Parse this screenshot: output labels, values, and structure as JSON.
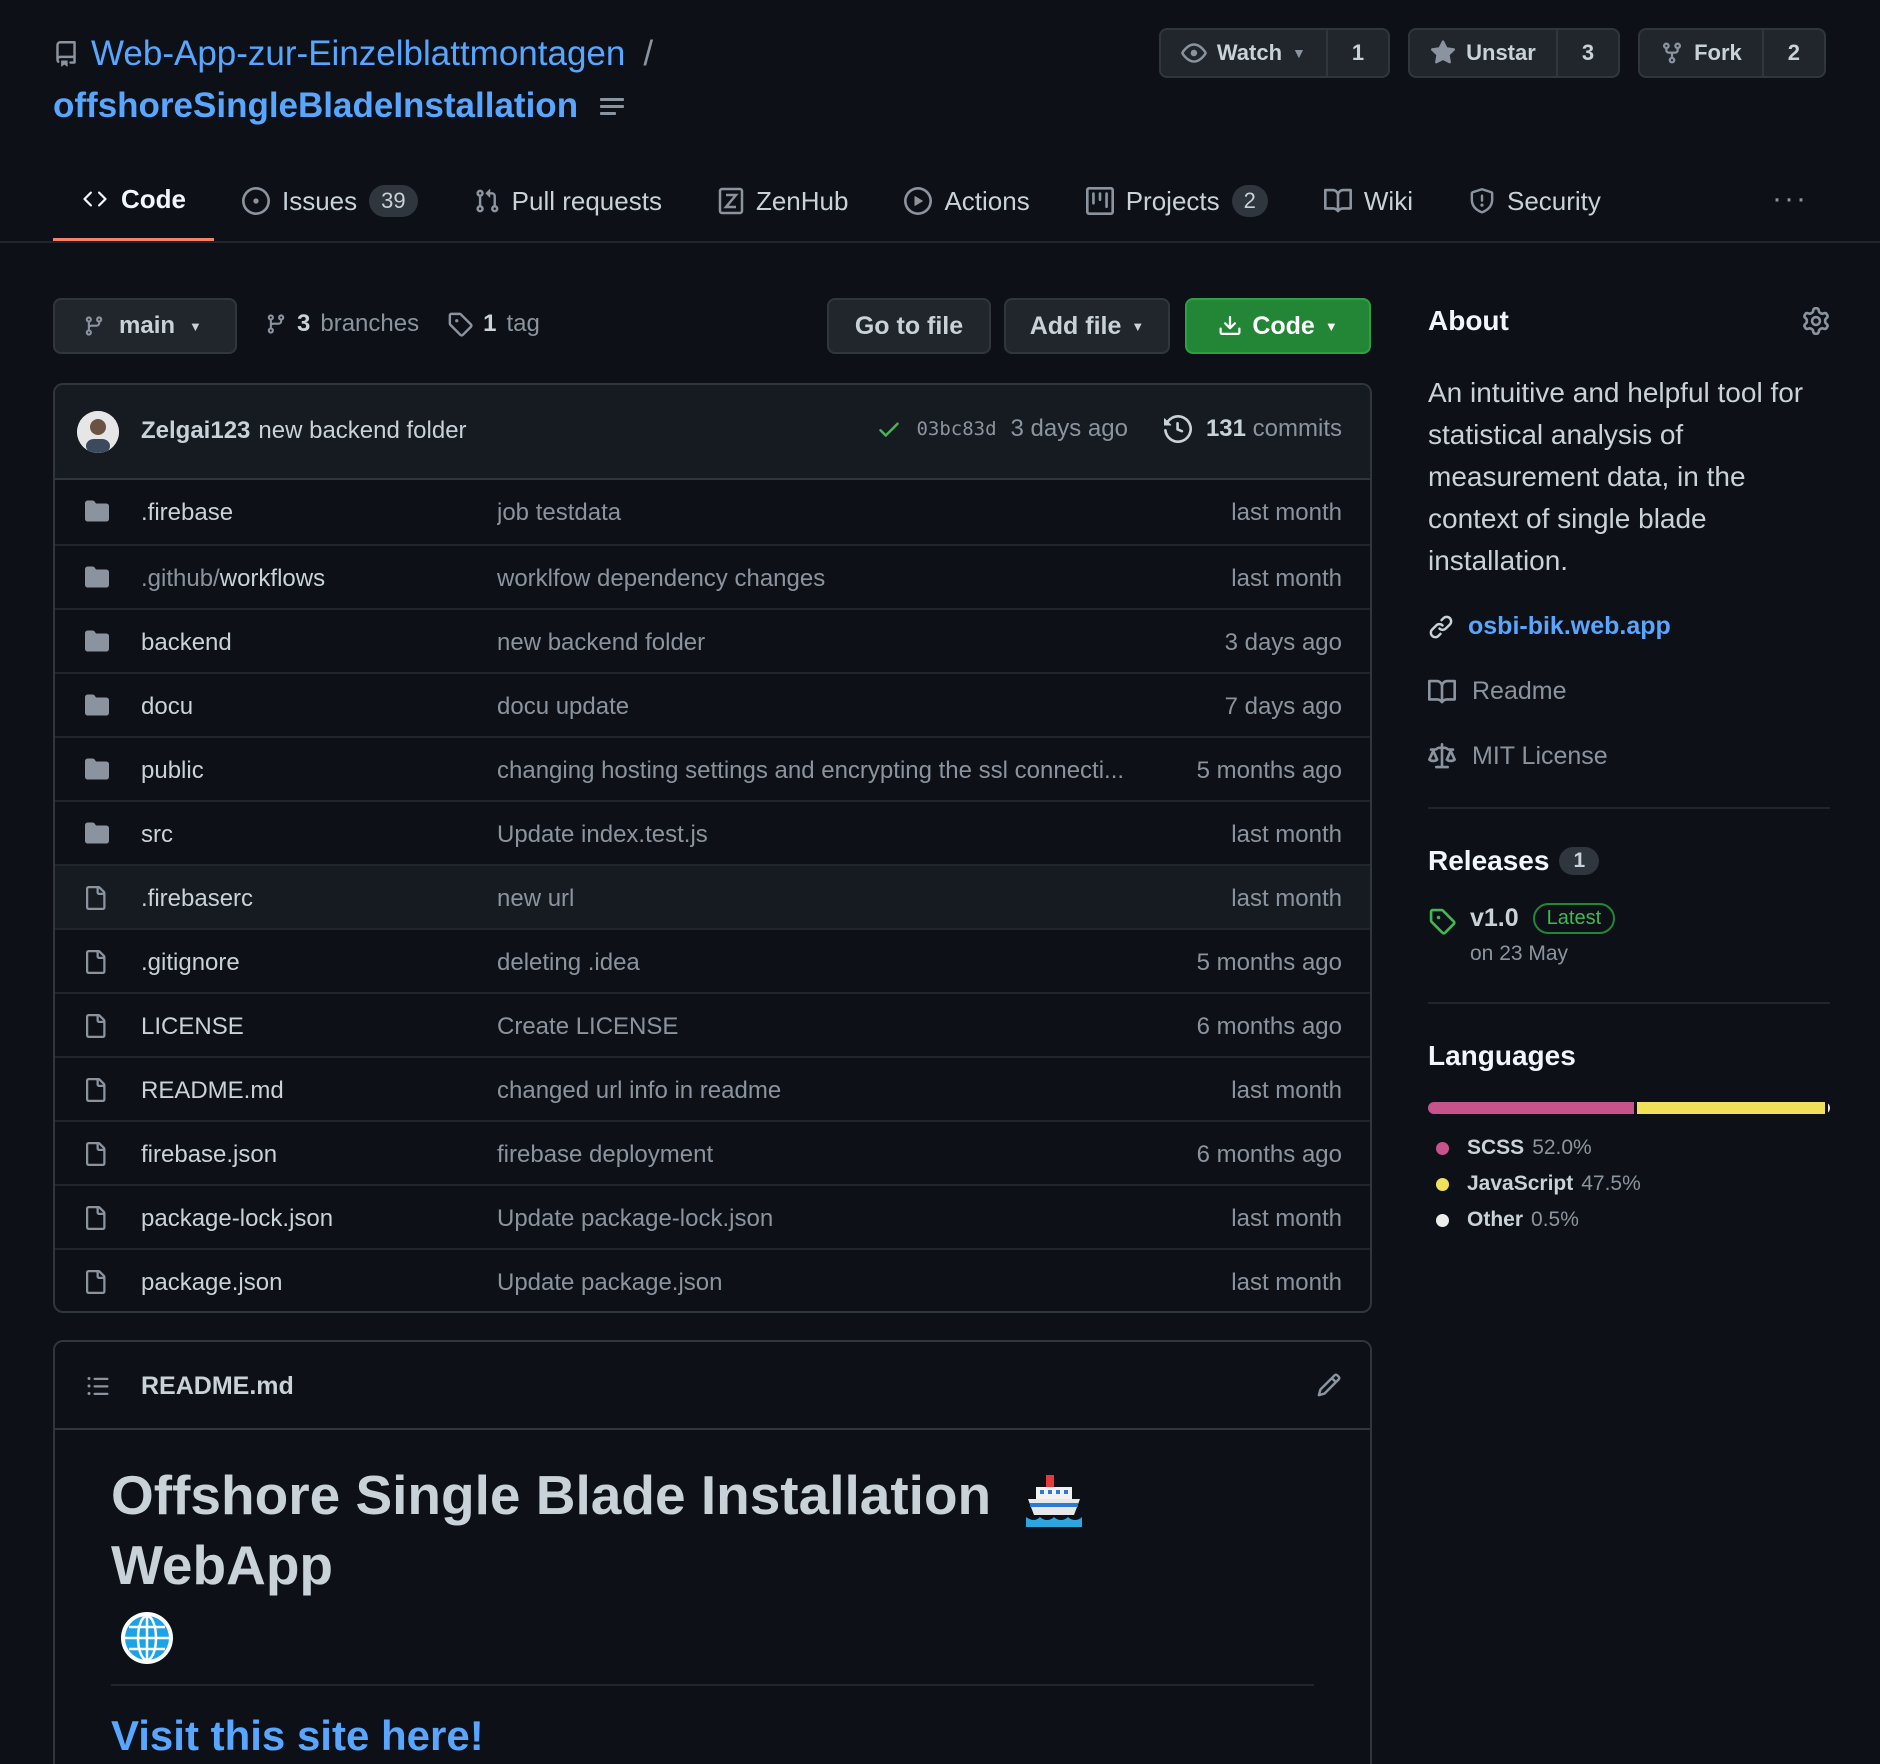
{
  "repo": {
    "owner": "Web-App-zur-Einzelblattmontagen",
    "name": "offshoreSingleBladeInstallation",
    "separator": "/"
  },
  "actions": {
    "watch_label": "Watch",
    "watch_count": "1",
    "star_label": "Unstar",
    "star_count": "3",
    "fork_label": "Fork",
    "fork_count": "2"
  },
  "tabs": [
    {
      "label": "Code"
    },
    {
      "label": "Issues",
      "badge": "39"
    },
    {
      "label": "Pull requests"
    },
    {
      "label": "ZenHub"
    },
    {
      "label": "Actions"
    },
    {
      "label": "Projects",
      "badge": "2"
    },
    {
      "label": "Wiki"
    },
    {
      "label": "Security"
    }
  ],
  "tabs_more": "···",
  "filenav": {
    "branch": "main",
    "branches_count": "3",
    "branches_label": "branches",
    "tags_count": "1",
    "tags_label": "tag",
    "go_to_file": "Go to file",
    "add_file": "Add file",
    "code": "Code"
  },
  "commit": {
    "author": "Zelgai123",
    "message": "new backend folder",
    "sha": "03bc83d",
    "time": "3 days ago",
    "commits_count": "131",
    "commits_label": "commits"
  },
  "files": [
    {
      "type": "dir",
      "name": ".firebase",
      "msg": "job testdata",
      "age": "last month"
    },
    {
      "type": "dir",
      "name_dim": ".github/",
      "name": "workflows",
      "msg": "worklfow dependency changes",
      "age": "last month"
    },
    {
      "type": "dir",
      "name": "backend",
      "msg": "new backend folder",
      "age": "3 days ago"
    },
    {
      "type": "dir",
      "name": "docu",
      "msg": "docu update",
      "age": "7 days ago"
    },
    {
      "type": "dir",
      "name": "public",
      "msg": "changing hosting settings and encrypting the ssl connecti...",
      "age": "5 months ago"
    },
    {
      "type": "dir",
      "name": "src",
      "msg": "Update index.test.js",
      "age": "last month"
    },
    {
      "type": "file",
      "name": ".firebaserc",
      "msg": "new url",
      "age": "last month"
    },
    {
      "type": "file",
      "name": ".gitignore",
      "msg": "deleting .idea",
      "age": "5 months ago"
    },
    {
      "type": "file",
      "name": "LICENSE",
      "msg": "Create LICENSE",
      "age": "6 months ago"
    },
    {
      "type": "file",
      "name": "README.md",
      "msg": "changed url info in readme",
      "age": "last month"
    },
    {
      "type": "file",
      "name": "firebase.json",
      "msg": "firebase deployment",
      "age": "6 months ago"
    },
    {
      "type": "file",
      "name": "package-lock.json",
      "msg": "Update package-lock.json",
      "age": "last month"
    },
    {
      "type": "file",
      "name": "package.json",
      "msg": "Update package.json",
      "age": "last month"
    }
  ],
  "readme": {
    "filename": "README.md",
    "h1_part1": "Offshore Single Blade Installation",
    "h1_part2": "WebApp",
    "h2": "Visit this site here!"
  },
  "about": {
    "title": "About",
    "description": "An intuitive and helpful tool for statistical analysis of measurement data, in the context of single blade installation.",
    "website": "osbi-bik.web.app",
    "readme": "Readme",
    "license": "MIT License"
  },
  "releases": {
    "title": "Releases",
    "count": "1",
    "version": "v1.0",
    "latest": "Latest",
    "date": "on 23 May"
  },
  "languages": {
    "title": "Languages",
    "items": [
      {
        "name": "SCSS",
        "pct": "52.0%",
        "value": 52.0,
        "color": "#c6538c"
      },
      {
        "name": "JavaScript",
        "pct": "47.5%",
        "value": 47.5,
        "color": "#f1e05a"
      },
      {
        "name": "Other",
        "pct": "0.5%",
        "value": 0.5,
        "color": "#ededed"
      }
    ]
  },
  "colors": {
    "accent": "#58a6ff",
    "code_button": "#238636",
    "active_tab": "#f78166"
  }
}
